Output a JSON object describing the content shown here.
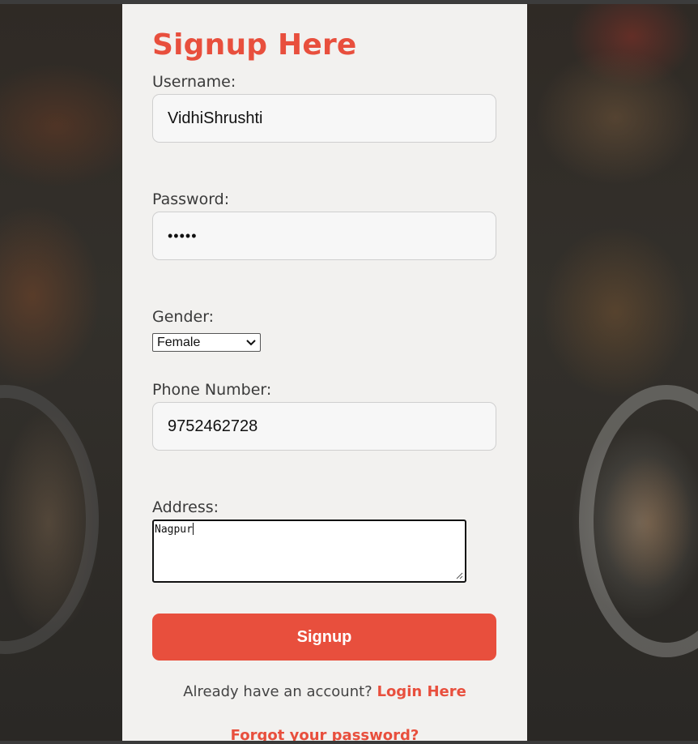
{
  "form": {
    "title": "Signup Here",
    "username": {
      "label": "Username:",
      "value": "VidhiShrushti"
    },
    "password": {
      "label": "Password:",
      "value": "•••••"
    },
    "gender": {
      "label": "Gender:",
      "selected": "Female"
    },
    "phone": {
      "label": "Phone Number:",
      "value": "9752462728"
    },
    "address": {
      "label": "Address:",
      "value": "Nagpur"
    },
    "submit_label": "Signup",
    "login_prompt": "Already have an account?",
    "login_link": "Login Here",
    "forgot_link": "Forgot your password?"
  },
  "colors": {
    "accent": "#e84f3d",
    "card_background": "#f2f1ef"
  },
  "icons": {
    "select_arrow": "chevron-down-icon",
    "textarea_resize": "resize-grip-icon"
  }
}
